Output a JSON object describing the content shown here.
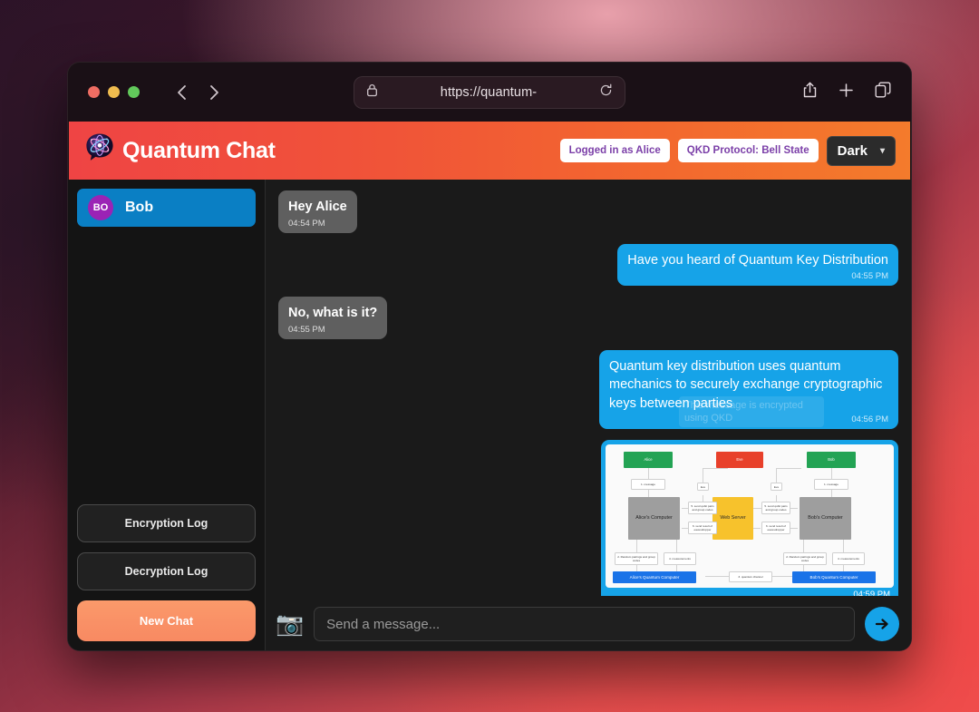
{
  "browser": {
    "url": "https://quantum-",
    "lock_icon": "lock-icon",
    "reload_icon": "reload-icon",
    "back_icon": "chevron-left-icon",
    "forward_icon": "chevron-right-icon",
    "share_icon": "share-icon",
    "new_tab_icon": "plus-icon",
    "tabs_icon": "tabs-icon"
  },
  "header": {
    "logo_icon": "quantum-atom-chat-icon",
    "title": "Quantum Chat",
    "badges": [
      {
        "label": "Logged in as Alice"
      },
      {
        "label": "QKD Protocol: Bell State"
      }
    ],
    "theme": {
      "value": "Dark",
      "caret": "▾"
    },
    "gradient_from": "#ef4444",
    "gradient_to": "#f47b2c"
  },
  "sidebar": {
    "contacts": [
      {
        "initials": "BO",
        "name": "Bob",
        "avatar_color": "#9b23b5",
        "active_color": "#0a7fc4"
      }
    ],
    "buttons": [
      {
        "label": "Encryption Log",
        "style": "outline"
      },
      {
        "label": "Decryption Log",
        "style": "outline"
      },
      {
        "label": "New Chat",
        "style": "primary"
      }
    ]
  },
  "chat": {
    "messages": [
      {
        "direction": "in",
        "text": "Hey Alice",
        "time": "04:54 PM"
      },
      {
        "direction": "out",
        "text": "Have you heard of Quantum Key Distribution",
        "time": "04:55 PM"
      },
      {
        "direction": "in",
        "text": "No, what is it?",
        "time": "04:55 PM"
      },
      {
        "direction": "out",
        "text": "Quantum key distribution uses quantum mechanics to securely exchange cryptographic keys between parties",
        "time": "04:56 PM",
        "tooltip": "This message is encrypted using QKD"
      },
      {
        "direction": "out",
        "type": "image",
        "time": "04:59 PM"
      }
    ],
    "bubble_in_color": "#5f5f5f",
    "bubble_out_color": "#16a3e8"
  },
  "diagram": {
    "nodes": {
      "alice": "Alice",
      "eve": "Eve",
      "bob": "Bob",
      "alice_computer": "Alice's Computer",
      "web_server": "Web Server",
      "bob_computer": "Bob's Computer",
      "alice_quantum": "Alice's Quantum Computer",
      "bob_quantum": "Bob's Quantum Computer"
    },
    "labels": {
      "message_left": "1. message",
      "message_right": "1. message",
      "eve_left": "Eve",
      "eve_right": "Eve",
      "qubit_left": "5. send qubit pairs and group codes",
      "qubit_right": "5. send qubit pairs and group codes",
      "result_left": "6. send result of eavesdropper",
      "result_right": "6. send result of eavesdropper",
      "random_left": "2. Random pairings and group codes",
      "random_right": "2. Random pairings and group codes",
      "measure_left": "4. measurements",
      "measure_right": "4. measurements",
      "channel": "3. quantum channel"
    }
  },
  "input": {
    "camera_icon": "camera-icon",
    "placeholder": "Send a message...",
    "value": "",
    "send_icon": "send-arrow-icon"
  }
}
